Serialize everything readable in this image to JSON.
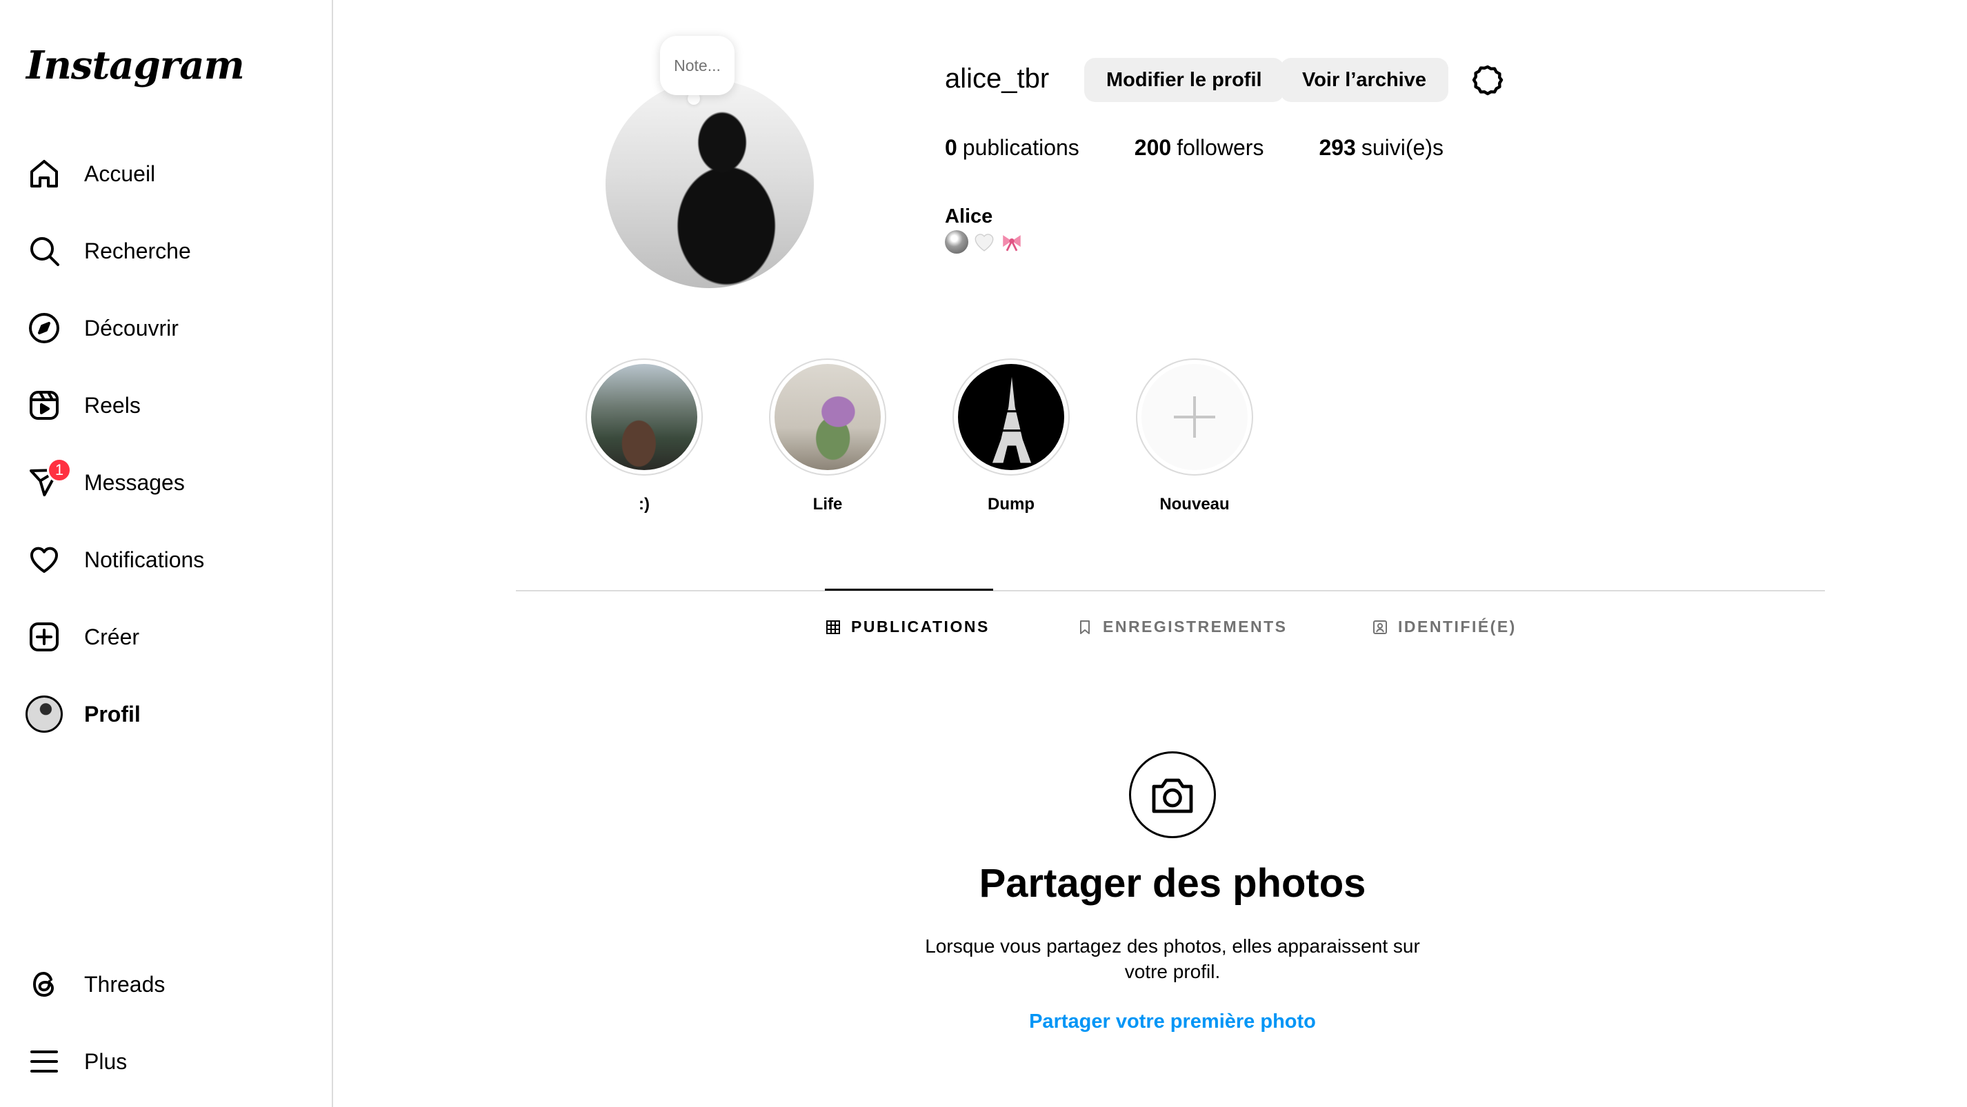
{
  "sidebar": {
    "logo": "Instagram",
    "items": [
      {
        "label": "Accueil"
      },
      {
        "label": "Recherche"
      },
      {
        "label": "Découvrir"
      },
      {
        "label": "Reels"
      },
      {
        "label": "Messages",
        "badge": "1"
      },
      {
        "label": "Notifications"
      },
      {
        "label": "Créer"
      },
      {
        "label": "Profil"
      }
    ],
    "bottom_items": [
      {
        "label": "Threads"
      },
      {
        "label": "Plus"
      }
    ]
  },
  "profile": {
    "note_placeholder": "Note...",
    "username": "alice_tbr",
    "edit_button": "Modifier le profil",
    "archive_button": "Voir l’archive",
    "stats": {
      "posts_count": "0",
      "posts_label": "publications",
      "followers_count": "200",
      "followers_label": "followers",
      "following_count": "293",
      "following_label": "suivi(e)s"
    },
    "full_name": "Alice"
  },
  "highlights": [
    {
      "label": ":)"
    },
    {
      "label": "Life"
    },
    {
      "label": "Dump"
    },
    {
      "label": "Nouveau"
    }
  ],
  "tabs": [
    {
      "label": "PUBLICATIONS",
      "active": true
    },
    {
      "label": "ENREGISTREMENTS",
      "active": false
    },
    {
      "label": "IDENTIFIÉ(E)",
      "active": false
    }
  ],
  "empty_state": {
    "title": "Partager des photos",
    "text": "Lorsque vous partagez des photos, elles apparaissent sur votre profil.",
    "link": "Partager votre première photo"
  },
  "colors": {
    "accent_link": "#0095f6",
    "badge": "#ff3040",
    "button_bg": "#efefef",
    "divider": "#dbdbdb"
  }
}
